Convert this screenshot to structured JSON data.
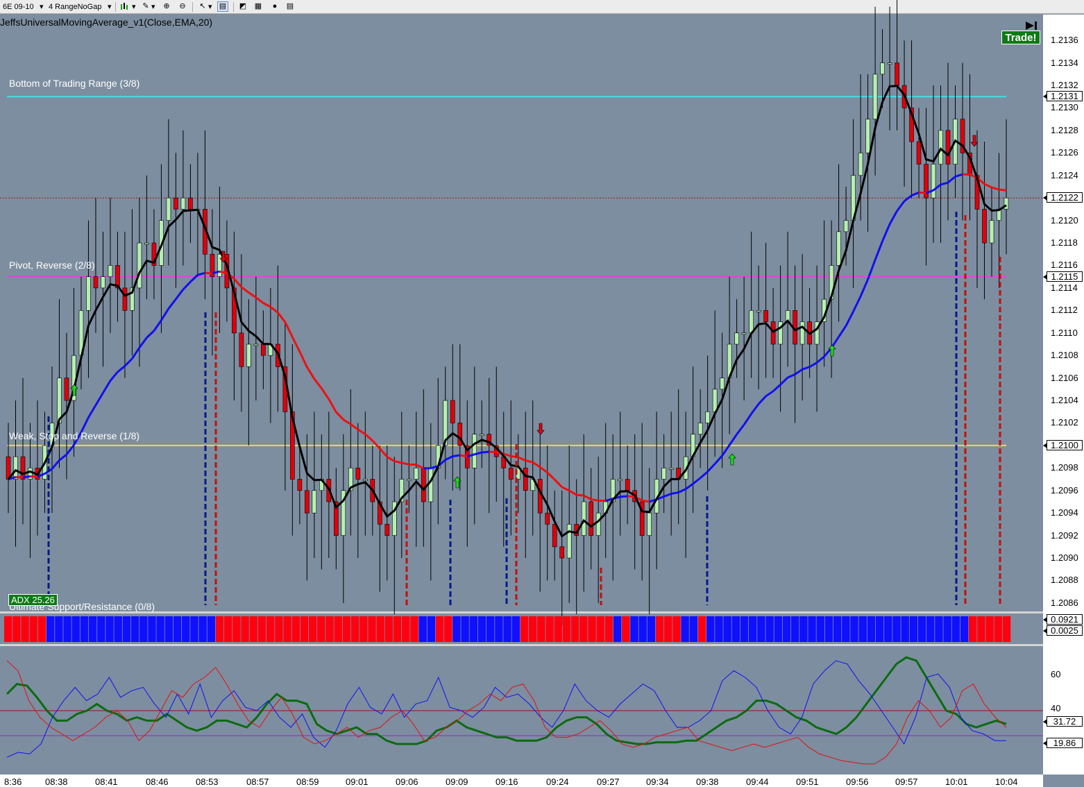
{
  "toolbar": {
    "instrument": "6E 09-10",
    "period": "4 RangeNoGap",
    "buttons": [
      "bar-type-icon",
      "draw-tool-icon",
      "zoom-in-icon",
      "zoom-out-icon",
      "cursor-icon",
      "data-box-icon",
      "strategy-icon",
      "properties-icon",
      "refresh-icon",
      "chart-trader-icon"
    ]
  },
  "chart": {
    "indicator_title": "JeffsUniversalMovingAverage_v1(Close,EMA,20)",
    "lines": [
      {
        "label": "Bottom of Trading Range (3/8)",
        "price": 1.2131,
        "color": "#3fe0e6"
      },
      {
        "label": "Pivot, Reverse (2/8)",
        "price": 1.2115,
        "color": "#e83ee8"
      },
      {
        "label": "Weak, Stop and Reverse (1/8)",
        "price": 1.21,
        "color": "#e8e040"
      },
      {
        "label": "Ultimate Support/Resistance (0/8)",
        "price": 1.2085,
        "color": "#ffffff"
      }
    ],
    "current_price": 1.2122,
    "trade_button": "Trade!",
    "adx_label": "ADX 25.26"
  },
  "price_axis": {
    "ticks": [
      "1.2136",
      "1.2134",
      "1.2132",
      "1.2130",
      "1.2128",
      "1.2126",
      "1.2124",
      "1.2122",
      "1.2120",
      "1.2118",
      "1.2116",
      "1.2114",
      "1.2112",
      "1.2110",
      "1.2108",
      "1.2106",
      "1.2104",
      "1.2102",
      "1.2100",
      "1.2098",
      "1.2096",
      "1.2094",
      "1.2092",
      "1.2090",
      "1.2088",
      "1.2086"
    ],
    "tags": [
      {
        "value": "1.2131",
        "name": "trading-range-price-tag"
      },
      {
        "value": "1.2122",
        "name": "last-price-tag"
      },
      {
        "value": "1.2115",
        "name": "pivot-price-tag"
      },
      {
        "value": "1.2100",
        "name": "weak-stop-price-tag"
      }
    ]
  },
  "panel2": {
    "tags": [
      "0.0921",
      "0.0025"
    ]
  },
  "panel3": {
    "ticks": [
      "60",
      "40"
    ],
    "levels": [
      40,
      25
    ],
    "tags": [
      "31.72",
      "19.86"
    ]
  },
  "time_axis": {
    "labels": [
      "8:36",
      "08:38",
      "08:41",
      "08:46",
      "08:53",
      "08:57",
      "08:59",
      "09:01",
      "09:06",
      "09:09",
      "09:16",
      "09:24",
      "09:27",
      "09:34",
      "09:38",
      "09:44",
      "09:51",
      "09:56",
      "09:57",
      "10:01",
      "10:04"
    ]
  },
  "colors": {
    "background": "#7d8ea0",
    "up_bar": "#b5f0b0",
    "down_bar": "#e0000a",
    "ema_slow_up": "#1010ee",
    "ema_slow_down": "#ee1010",
    "ma_fast": "#000000"
  }
}
